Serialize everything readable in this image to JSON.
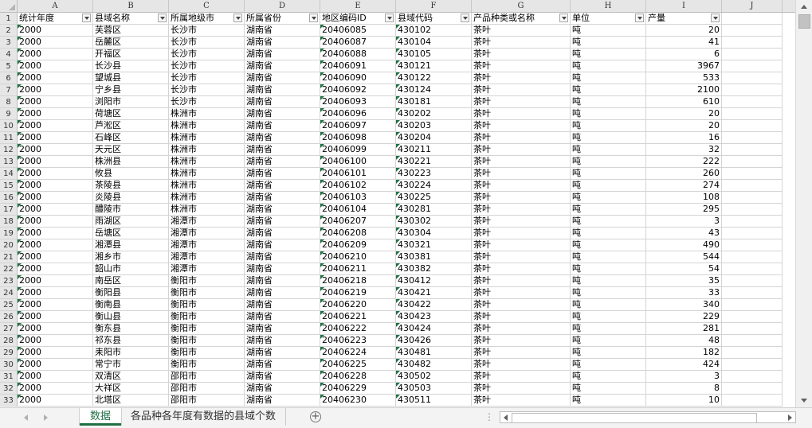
{
  "columns": [
    "A",
    "B",
    "C",
    "D",
    "E",
    "F",
    "G",
    "H",
    "I",
    "J"
  ],
  "headers": [
    "统计年度",
    "县域名称",
    "所属地级市",
    "所属省份",
    "地区编码ID",
    "县域代码",
    "产品种类或名称",
    "单位",
    "产量"
  ],
  "rows": [
    [
      "2000",
      "芙蓉区",
      "长沙市",
      "湖南省",
      "20406085",
      "430102",
      "茶叶",
      "吨",
      "20"
    ],
    [
      "2000",
      "岳麓区",
      "长沙市",
      "湖南省",
      "20406087",
      "430104",
      "茶叶",
      "吨",
      "41"
    ],
    [
      "2000",
      "开福区",
      "长沙市",
      "湖南省",
      "20406088",
      "430105",
      "茶叶",
      "吨",
      "6"
    ],
    [
      "2000",
      "长沙县",
      "长沙市",
      "湖南省",
      "20406091",
      "430121",
      "茶叶",
      "吨",
      "3967"
    ],
    [
      "2000",
      "望城县",
      "长沙市",
      "湖南省",
      "20406090",
      "430122",
      "茶叶",
      "吨",
      "533"
    ],
    [
      "2000",
      "宁乡县",
      "长沙市",
      "湖南省",
      "20406092",
      "430124",
      "茶叶",
      "吨",
      "2100"
    ],
    [
      "2000",
      "浏阳市",
      "长沙市",
      "湖南省",
      "20406093",
      "430181",
      "茶叶",
      "吨",
      "610"
    ],
    [
      "2000",
      "荷塘区",
      "株洲市",
      "湖南省",
      "20406096",
      "430202",
      "茶叶",
      "吨",
      "20"
    ],
    [
      "2000",
      "芦淞区",
      "株洲市",
      "湖南省",
      "20406097",
      "430203",
      "茶叶",
      "吨",
      "20"
    ],
    [
      "2000",
      "石峰区",
      "株洲市",
      "湖南省",
      "20406098",
      "430204",
      "茶叶",
      "吨",
      "16"
    ],
    [
      "2000",
      "天元区",
      "株洲市",
      "湖南省",
      "20406099",
      "430211",
      "茶叶",
      "吨",
      "32"
    ],
    [
      "2000",
      "株洲县",
      "株洲市",
      "湖南省",
      "20406100",
      "430221",
      "茶叶",
      "吨",
      "222"
    ],
    [
      "2000",
      "攸县",
      "株洲市",
      "湖南省",
      "20406101",
      "430223",
      "茶叶",
      "吨",
      "260"
    ],
    [
      "2000",
      "茶陵县",
      "株洲市",
      "湖南省",
      "20406102",
      "430224",
      "茶叶",
      "吨",
      "274"
    ],
    [
      "2000",
      "炎陵县",
      "株洲市",
      "湖南省",
      "20406103",
      "430225",
      "茶叶",
      "吨",
      "108"
    ],
    [
      "2000",
      "醴陵市",
      "株洲市",
      "湖南省",
      "20406104",
      "430281",
      "茶叶",
      "吨",
      "295"
    ],
    [
      "2000",
      "雨湖区",
      "湘潭市",
      "湖南省",
      "20406207",
      "430302",
      "茶叶",
      "吨",
      "3"
    ],
    [
      "2000",
      "岳塘区",
      "湘潭市",
      "湖南省",
      "20406208",
      "430304",
      "茶叶",
      "吨",
      "43"
    ],
    [
      "2000",
      "湘潭县",
      "湘潭市",
      "湖南省",
      "20406209",
      "430321",
      "茶叶",
      "吨",
      "490"
    ],
    [
      "2000",
      "湘乡市",
      "湘潭市",
      "湖南省",
      "20406210",
      "430381",
      "茶叶",
      "吨",
      "544"
    ],
    [
      "2000",
      "韶山市",
      "湘潭市",
      "湖南省",
      "20406211",
      "430382",
      "茶叶",
      "吨",
      "54"
    ],
    [
      "2000",
      "南岳区",
      "衡阳市",
      "湖南省",
      "20406218",
      "430412",
      "茶叶",
      "吨",
      "35"
    ],
    [
      "2000",
      "衡阳县",
      "衡阳市",
      "湖南省",
      "20406219",
      "430421",
      "茶叶",
      "吨",
      "33"
    ],
    [
      "2000",
      "衡南县",
      "衡阳市",
      "湖南省",
      "20406220",
      "430422",
      "茶叶",
      "吨",
      "340"
    ],
    [
      "2000",
      "衡山县",
      "衡阳市",
      "湖南省",
      "20406221",
      "430423",
      "茶叶",
      "吨",
      "229"
    ],
    [
      "2000",
      "衡东县",
      "衡阳市",
      "湖南省",
      "20406222",
      "430424",
      "茶叶",
      "吨",
      "281"
    ],
    [
      "2000",
      "祁东县",
      "衡阳市",
      "湖南省",
      "20406223",
      "430426",
      "茶叶",
      "吨",
      "48"
    ],
    [
      "2000",
      "耒阳市",
      "衡阳市",
      "湖南省",
      "20406224",
      "430481",
      "茶叶",
      "吨",
      "182"
    ],
    [
      "2000",
      "常宁市",
      "衡阳市",
      "湖南省",
      "20406225",
      "430482",
      "茶叶",
      "吨",
      "424"
    ],
    [
      "2000",
      "双清区",
      "邵阳市",
      "湖南省",
      "20406228",
      "430502",
      "茶叶",
      "吨",
      "3"
    ],
    [
      "2000",
      "大祥区",
      "邵阳市",
      "湖南省",
      "20406229",
      "430503",
      "茶叶",
      "吨",
      "8"
    ],
    [
      "2000",
      "北塔区",
      "邵阳市",
      "湖南省",
      "20406230",
      "430511",
      "茶叶",
      "吨",
      "10"
    ]
  ],
  "sheets": {
    "active": "数据",
    "other": "各品种各年度有数据的县域个数",
    "add_label": "+"
  },
  "overflow_dots": "⋮"
}
